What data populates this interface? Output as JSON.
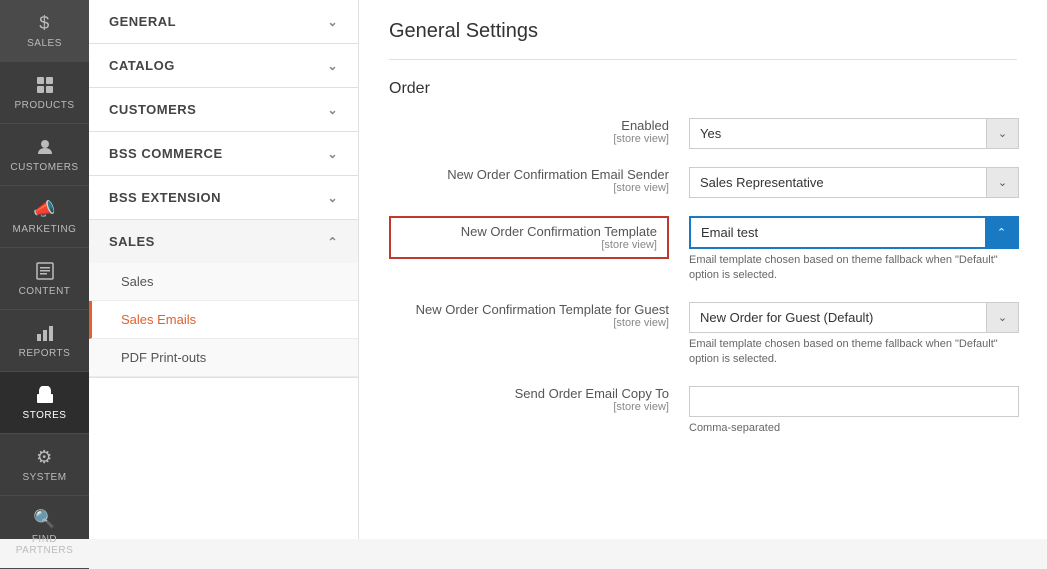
{
  "sidebar": {
    "items": [
      {
        "id": "sales",
        "label": "SALES",
        "icon": "💲"
      },
      {
        "id": "products",
        "label": "PRODUCTS",
        "icon": "📦"
      },
      {
        "id": "customers",
        "label": "CUSTOMERS",
        "icon": "👤"
      },
      {
        "id": "marketing",
        "label": "MARKETING",
        "icon": "📣"
      },
      {
        "id": "content",
        "label": "CONTENT",
        "icon": "▦"
      },
      {
        "id": "reports",
        "label": "REPORTS",
        "icon": "📊"
      },
      {
        "id": "stores",
        "label": "STORES",
        "icon": "🏪"
      },
      {
        "id": "system",
        "label": "SYSTEM",
        "icon": "⚙"
      },
      {
        "id": "find-partners",
        "label": "FIND PARTNERS",
        "icon": "🔍"
      }
    ]
  },
  "nav": {
    "sections": [
      {
        "id": "general",
        "label": "GENERAL",
        "expanded": false
      },
      {
        "id": "catalog",
        "label": "CATALOG",
        "expanded": false
      },
      {
        "id": "customers",
        "label": "CUSTOMERS",
        "expanded": false
      },
      {
        "id": "bss-commerce",
        "label": "BSS COMMERCE",
        "expanded": false
      },
      {
        "id": "bss-extension",
        "label": "BSS EXTENSION",
        "expanded": false
      },
      {
        "id": "sales",
        "label": "SALES",
        "expanded": true,
        "sub_items": [
          {
            "id": "sales",
            "label": "Sales",
            "active": false
          },
          {
            "id": "sales-emails",
            "label": "Sales Emails",
            "active": true
          },
          {
            "id": "pdf-printouts",
            "label": "PDF Print-outs",
            "active": false
          }
        ]
      }
    ]
  },
  "main": {
    "page_title": "General Settings",
    "section_heading": "Order",
    "fields": [
      {
        "id": "enabled",
        "label": "Enabled",
        "sub_label": "[store view]",
        "type": "select",
        "value": "Yes",
        "highlighted": false,
        "hint": ""
      },
      {
        "id": "new-order-email-sender",
        "label": "New Order Confirmation Email Sender",
        "sub_label": "[store view]",
        "type": "select",
        "value": "Sales Representative",
        "highlighted": false,
        "hint": ""
      },
      {
        "id": "new-order-template",
        "label": "New Order Confirmation Template",
        "sub_label": "[store view]",
        "type": "select",
        "value": "Email test",
        "highlighted": true,
        "hint": "Email template chosen based on theme fallback when \"Default\" option is selected.",
        "active_arrow": true
      },
      {
        "id": "new-order-guest-template",
        "label": "New Order Confirmation Template for Guest",
        "sub_label": "[store view]",
        "type": "select",
        "value": "New Order for Guest (Default)",
        "highlighted": false,
        "hint": "Email template chosen based on theme fallback when \"Default\" option is selected."
      },
      {
        "id": "send-order-email-copy",
        "label": "Send Order Email Copy To",
        "sub_label": "[store view]",
        "type": "text",
        "value": "",
        "highlighted": false,
        "hint": "Comma-separated"
      }
    ]
  }
}
